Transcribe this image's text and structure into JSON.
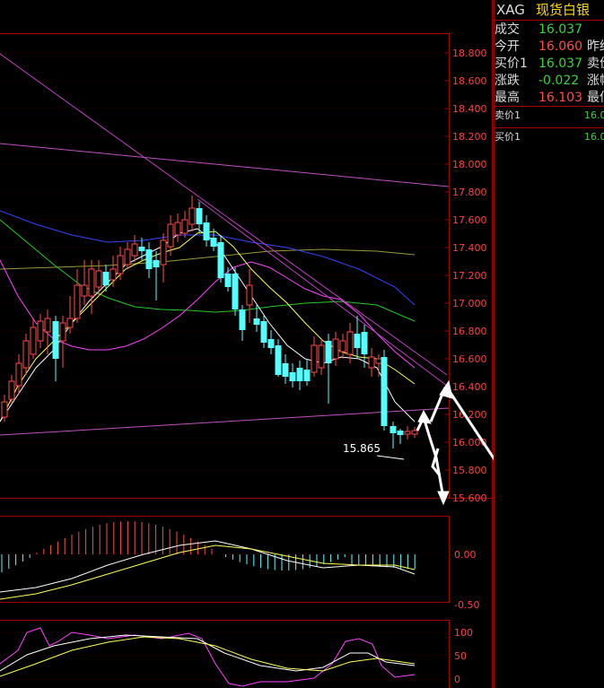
{
  "quote": {
    "symbol": "XAG",
    "name": "现货白银",
    "rows": [
      {
        "label": "成交",
        "value": "16.037",
        "value_color": "down",
        "label2": ""
      },
      {
        "label": "今开",
        "value": "16.060",
        "value_color": "up",
        "label2": "昨结"
      },
      {
        "label": "买价1",
        "value": "16.037",
        "value_color": "down",
        "label2": "卖价"
      },
      {
        "label": "涨跌",
        "value": "-0.022",
        "value_color": "down",
        "label2": "涨幅"
      },
      {
        "label": "最高",
        "value": "16.103",
        "value_color": "up",
        "label2": "最低"
      }
    ],
    "ask1_label": "卖价1",
    "ask1_value": "16.0",
    "bid1_label": "买价1",
    "bid1_value": "16.0"
  },
  "main_chart": {
    "y_ticks": [
      "18.800",
      "18.600",
      "18.400",
      "18.200",
      "18.000",
      "17.800",
      "17.600",
      "17.400",
      "17.200",
      "17.000",
      "16.800",
      "16.600",
      "16.400",
      "16.200",
      "16.000",
      "15.800",
      "15.600"
    ],
    "low_annotation": "15.865"
  },
  "macd_panel": {
    "y_ticks": [
      "0.00",
      "-0.50"
    ]
  },
  "kdj_panel": {
    "y_ticks": [
      "100",
      "50",
      "0"
    ]
  },
  "colors": {
    "up": "#ff4b4b",
    "down": "#3cd23c",
    "bear_candle": "#54ffff",
    "grid": "#a00000",
    "ma_white": "#ffffff",
    "ma_yellow": "#ffff55",
    "ma_magenta": "#ff44ff",
    "ma_green": "#22cc22",
    "ma_blue": "#3344ff",
    "ma_olive": "#999933"
  }
}
